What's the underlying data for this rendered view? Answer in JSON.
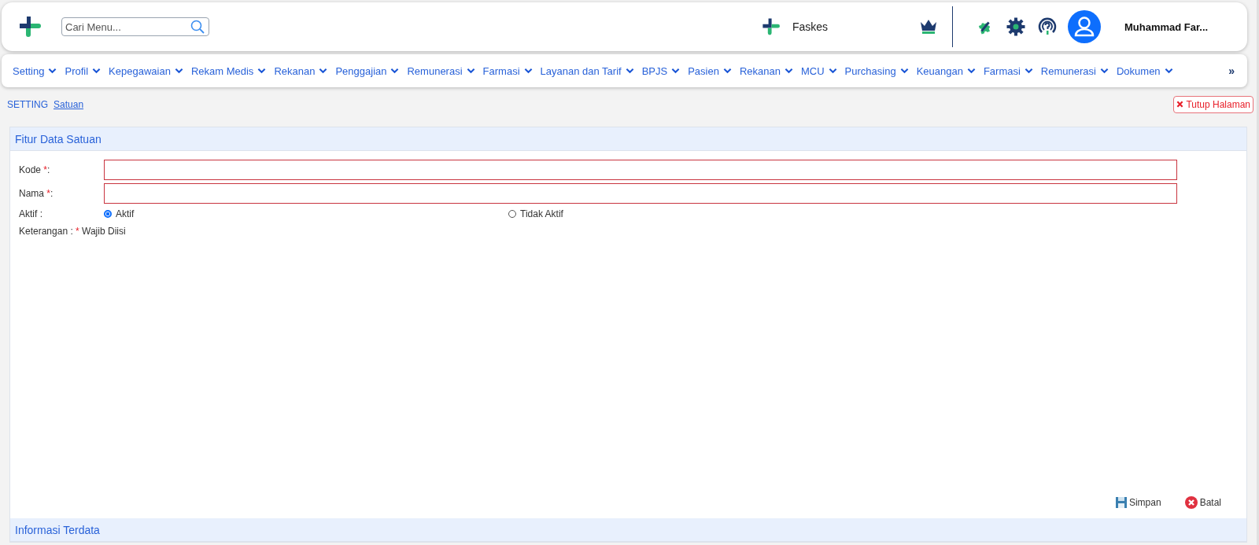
{
  "header": {
    "search": {
      "placeholder": "Cari Menu..."
    },
    "facility": "Faskes",
    "user": "Muhammad Far..."
  },
  "nav": {
    "items": [
      {
        "label": "Setting"
      },
      {
        "label": "Profil"
      },
      {
        "label": "Kepegawaian"
      },
      {
        "label": "Rekam Medis"
      },
      {
        "label": "Rekanan"
      },
      {
        "label": "Penggajian"
      },
      {
        "label": "Remunerasi"
      },
      {
        "label": "Farmasi"
      },
      {
        "label": "Layanan dan Tarif"
      },
      {
        "label": "BPJS"
      },
      {
        "label": "Pasien"
      },
      {
        "label": "Rekanan"
      },
      {
        "label": "MCU"
      },
      {
        "label": "Purchasing"
      },
      {
        "label": "Keuangan"
      },
      {
        "label": "Farmasi"
      },
      {
        "label": "Remunerasi"
      },
      {
        "label": "Dokumen"
      }
    ],
    "more": "»"
  },
  "breadcrumb": {
    "root": "SETTING",
    "current": "Satuan"
  },
  "close_button": "Tutup Halaman",
  "form": {
    "title": "Fitur Data Satuan",
    "fields": [
      {
        "label": "Kode ",
        "mark": "*",
        "suffix": ":"
      },
      {
        "label": "Nama ",
        "mark": "*",
        "suffix": ":"
      }
    ],
    "status": {
      "label": "Aktif :",
      "options": [
        {
          "label": "Aktif",
          "selected": true
        },
        {
          "label": "Tidak Aktif",
          "selected": false
        }
      ]
    },
    "note": {
      "prefix": "Keterangan : ",
      "mark": "*",
      "text": " Wajib Diisi"
    },
    "buttons": [
      {
        "kind": "save",
        "label": "Simpan"
      },
      {
        "kind": "cancel",
        "label": "Batal"
      }
    ]
  },
  "info_title": "Informasi Terdata"
}
